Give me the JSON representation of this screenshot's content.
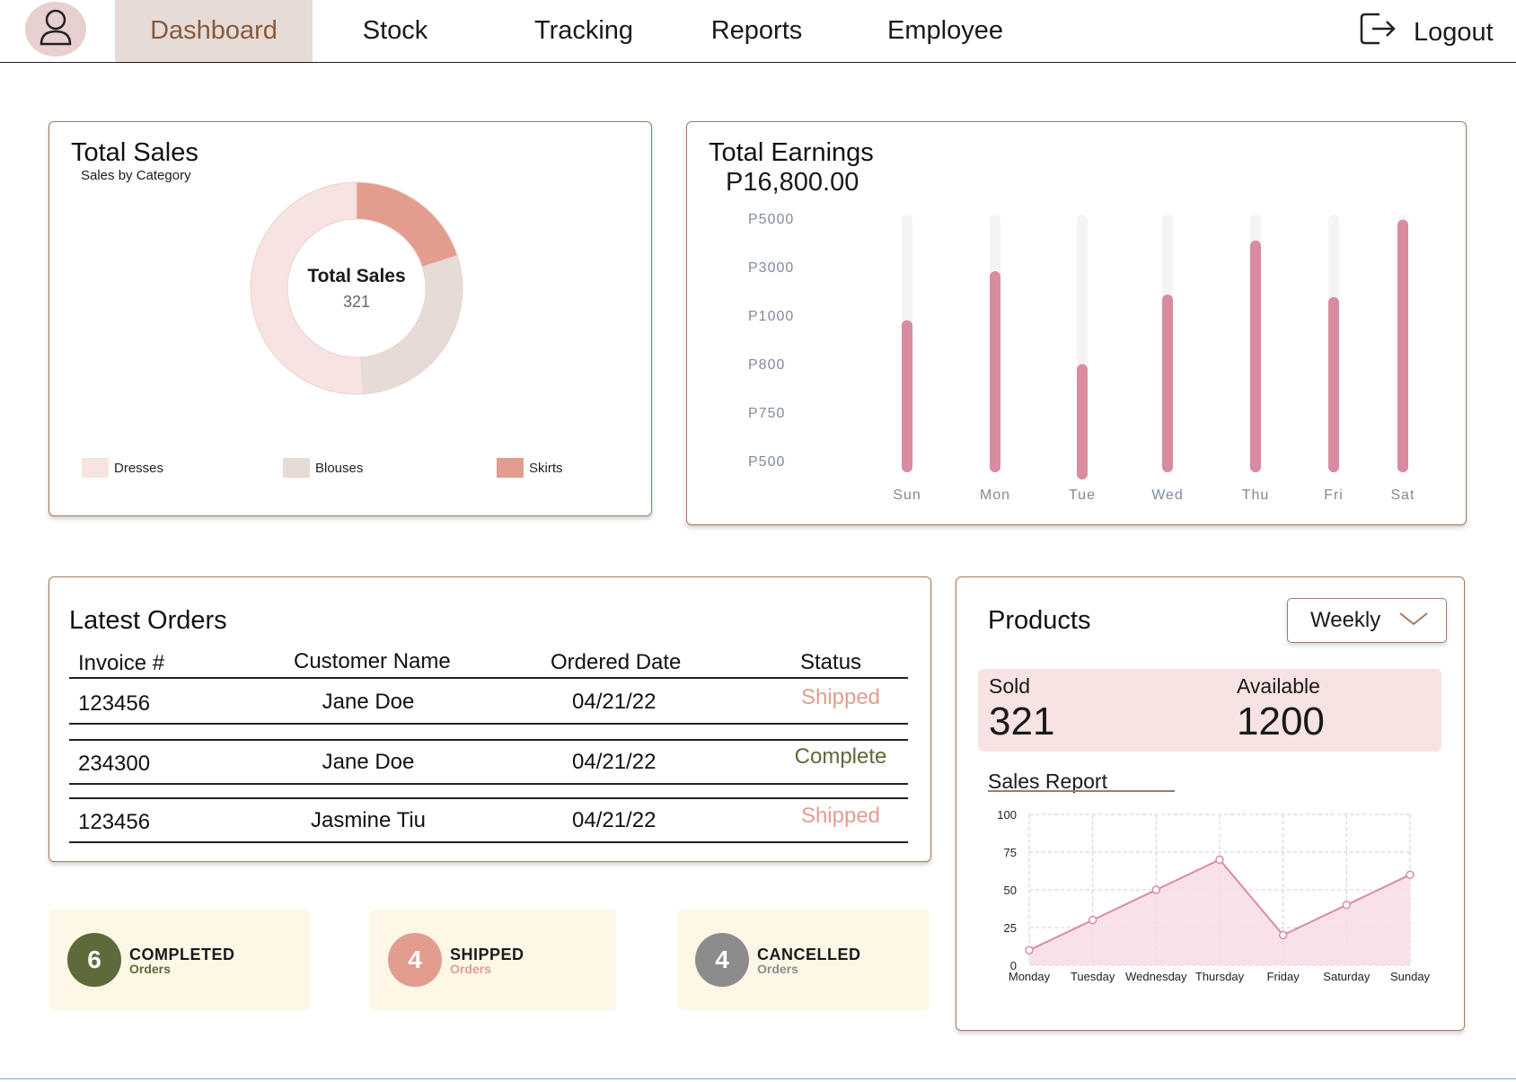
{
  "nav": {
    "items": [
      {
        "label": "Dashboard",
        "active": true
      },
      {
        "label": "Stock",
        "active": false
      },
      {
        "label": "Tracking",
        "active": false
      },
      {
        "label": "Reports",
        "active": false
      },
      {
        "label": "Employee",
        "active": false
      }
    ],
    "logout_label": "Logout",
    "avatar_icon": "user-icon",
    "logout_icon": "logout-icon"
  },
  "total_sales": {
    "title": "Total Sales",
    "subtitle": "Sales by Category",
    "center_label": "Total Sales",
    "center_value": "321",
    "legend": [
      {
        "label": "Dresses",
        "color": "#f8e3e3"
      },
      {
        "label": "Blouses",
        "color": "#e6dbd6"
      },
      {
        "label": "Skirts",
        "color": "#e29d8f"
      }
    ]
  },
  "total_earnings": {
    "title": "Total Earnings",
    "amount": "P16,800.00",
    "y_labels": [
      "P5000",
      "P3000",
      "P1000",
      "P800",
      "P750",
      "P500"
    ]
  },
  "latest_orders": {
    "title": "Latest Orders",
    "columns": [
      "Invoice #",
      "Customer Name",
      "Ordered Date",
      "Status"
    ],
    "rows": [
      {
        "invoice": "123456",
        "customer": "Jane Doe",
        "date": "04/21/22",
        "status": "Shipped"
      },
      {
        "invoice": "234300",
        "customer": "Jane Doe",
        "date": "04/21/22",
        "status": "Complete"
      },
      {
        "invoice": "123456",
        "customer": "Jasmine Tiu",
        "date": "04/21/22",
        "status": "Shipped"
      }
    ]
  },
  "order_tiles": [
    {
      "count": "6",
      "label": "COMPLETED",
      "sub": "Orders",
      "circle_color": "#5d6a3a",
      "sub_color": "#5d6a3a"
    },
    {
      "count": "4",
      "label": "SHIPPED",
      "sub": "Orders",
      "circle_color": "#e29d8f",
      "sub_color": "#e29d8f"
    },
    {
      "count": "4",
      "label": "CANCELLED",
      "sub": "Orders",
      "circle_color": "#8c8c8c",
      "sub_color": "#8c8c8c"
    }
  ],
  "products": {
    "title": "Products",
    "period_select": "Weekly",
    "sold_label": "Sold",
    "sold_value": "321",
    "available_label": "Available",
    "available_value": "1200",
    "report_title": "Sales Report"
  },
  "colors": {
    "accent": "#d98ba0",
    "brown_border": "#a27a5f",
    "shipped": "#e29d8f",
    "complete": "#5d6a3a"
  },
  "chart_data": [
    {
      "type": "pie",
      "title": "Total Sales",
      "subtitle": "Sales by Category",
      "categories": [
        "Dresses",
        "Blouses",
        "Skirts"
      ],
      "values": [
        51,
        29,
        20
      ],
      "colors": [
        "#f8e3e3",
        "#e6dbd6",
        "#e29d8f"
      ],
      "donut": true,
      "center_label": "Total Sales",
      "center_value": "321",
      "legend": "bottom"
    },
    {
      "type": "bar",
      "title": "Total Earnings",
      "categories": [
        "Sun",
        "Mon",
        "Tue",
        "Wed",
        "Thu",
        "Fri",
        "Sat"
      ],
      "values": [
        0.59,
        0.78,
        0.42,
        0.69,
        0.9,
        0.68,
        0.98
      ],
      "y_tick_labels": [
        "P5000",
        "P3000",
        "P1000",
        "P800",
        "P750",
        "P500"
      ],
      "bar_color": "#d98ba0",
      "track_color": "#f4f4f4",
      "grid": false
    },
    {
      "type": "area",
      "title": "Sales Report",
      "categories": [
        "Monday",
        "Tuesday",
        "Wednesday",
        "Thursday",
        "Friday",
        "Saturday",
        "Sunday"
      ],
      "values": [
        10,
        30,
        50,
        70,
        20,
        40,
        60
      ],
      "ylim": [
        0,
        100
      ],
      "y_ticks": [
        0,
        25,
        50,
        75,
        100
      ],
      "line_color": "#d98ba0",
      "fill_color": "#f7dde3",
      "grid": true
    }
  ]
}
